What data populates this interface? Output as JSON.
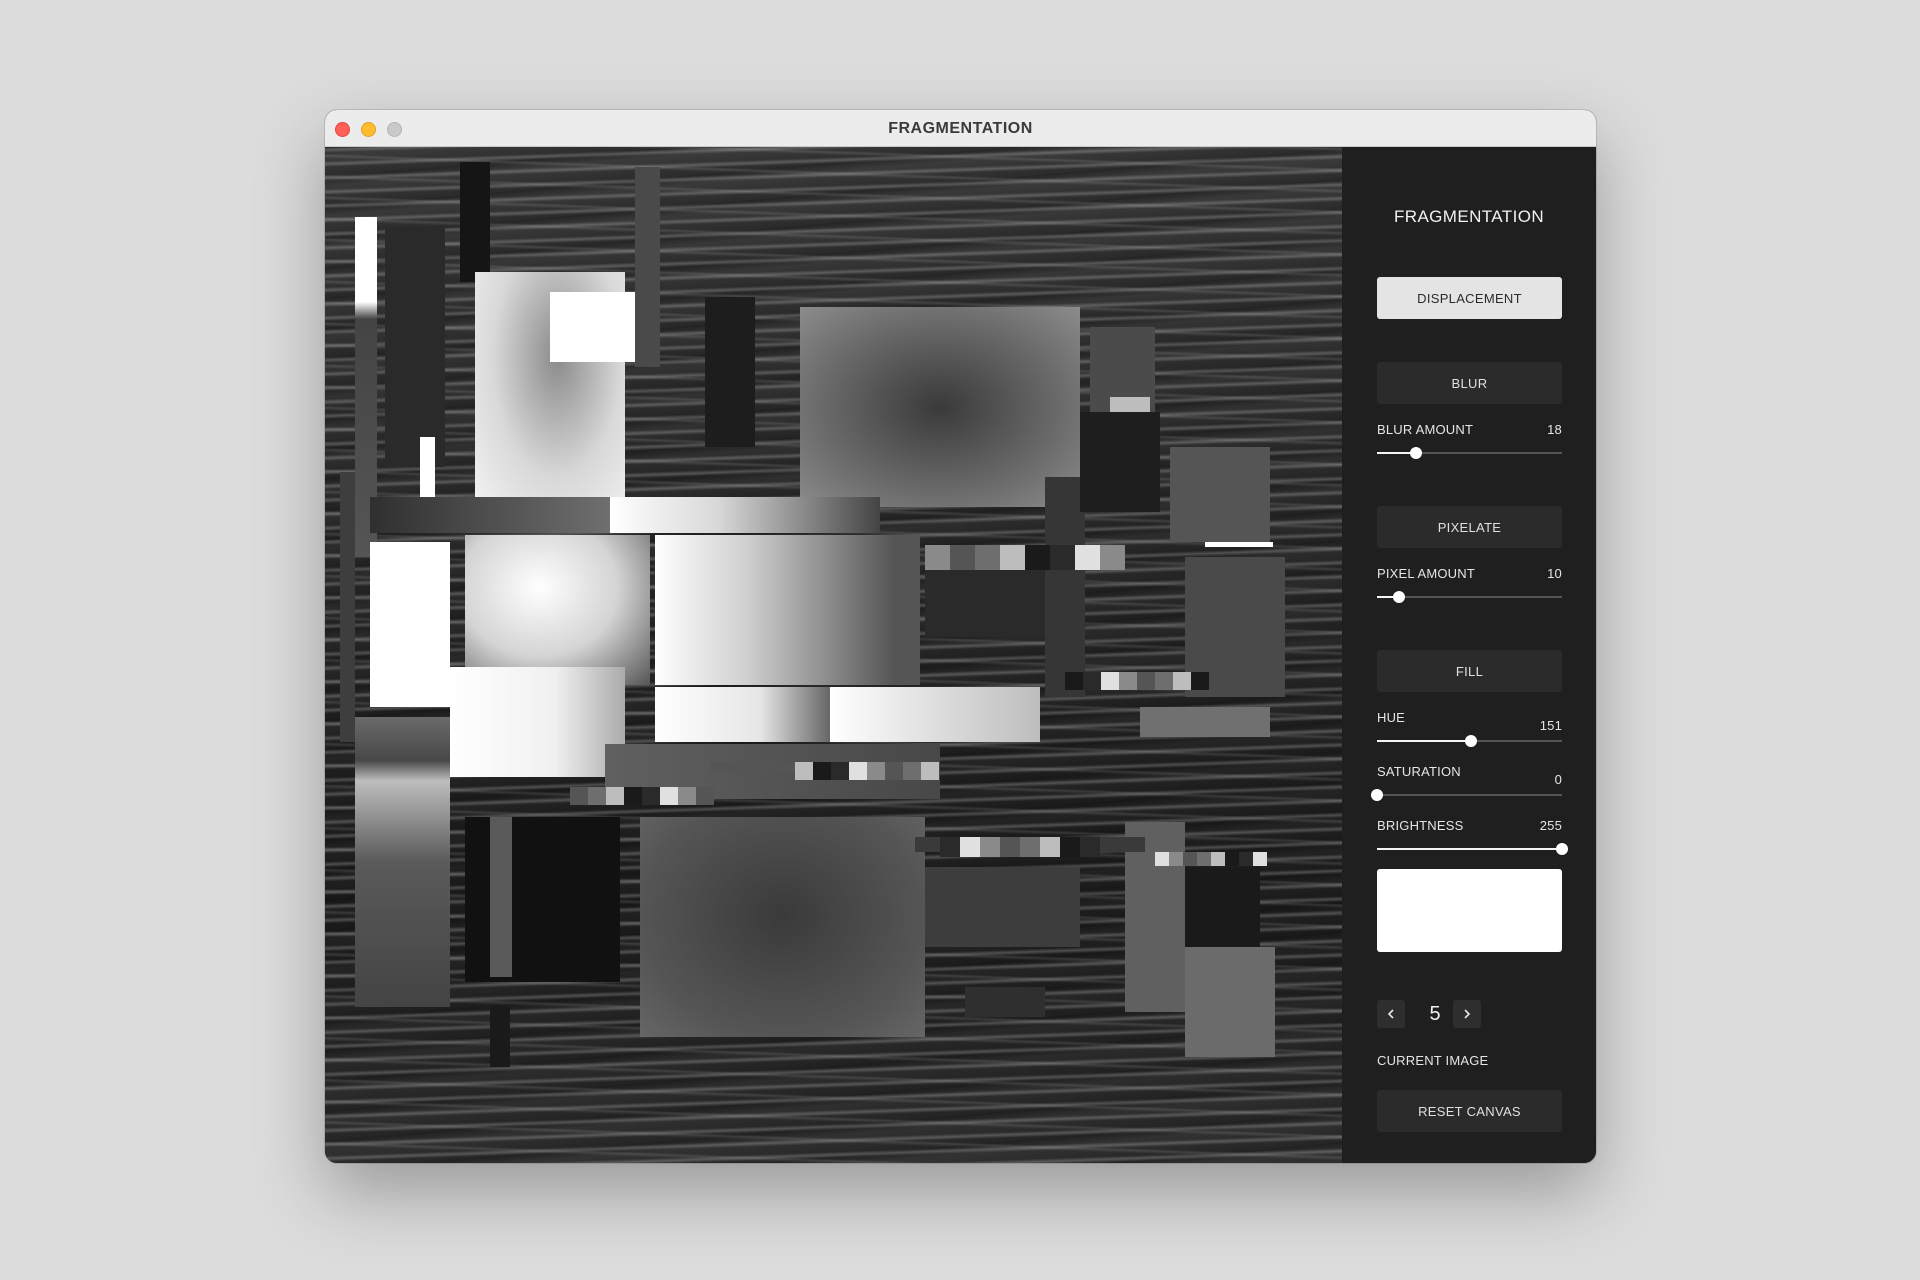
{
  "window": {
    "title": "FRAGMENTATION"
  },
  "panel": {
    "title": "FRAGMENTATION",
    "displacement_label": "DISPLACEMENT",
    "blur_label": "BLUR",
    "blur_amount": {
      "label": "BLUR AMOUNT",
      "value": "18",
      "fraction": 0.21
    },
    "pixelate_label": "PIXELATE",
    "pixel_amount": {
      "label": "PIXEL AMOUNT",
      "value": "10",
      "fraction": 0.12
    },
    "fill_label": "FILL",
    "hue": {
      "label": "HUE",
      "value": "151",
      "fraction": 0.51
    },
    "saturation": {
      "label": "SATURATION",
      "value": "0",
      "fraction": 0.0
    },
    "brightness": {
      "label": "BRIGHTNESS",
      "value": "255",
      "fraction": 1.0
    },
    "fill_color": "#ffffff",
    "current_image": {
      "number": "5",
      "label": "CURRENT IMAGE"
    },
    "reset_label": "RESET CANVAS"
  },
  "icons": {
    "prev": "chevron-left-icon",
    "next": "chevron-right-icon"
  },
  "colors": {
    "panel_bg": "#1f1f1f",
    "active_button": "#e4e4e4",
    "button_bg": "#2b2b2b"
  }
}
